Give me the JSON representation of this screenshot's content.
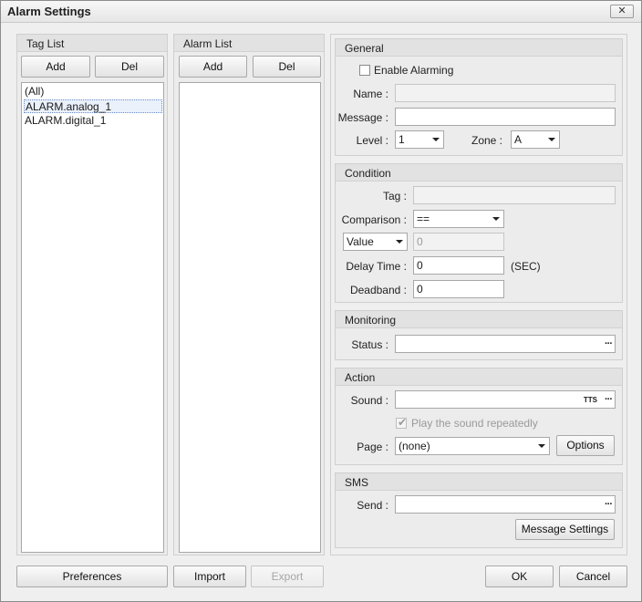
{
  "window": {
    "title": "Alarm Settings",
    "close_glyph": "✕"
  },
  "tag_list": {
    "title": "Tag List",
    "add_label": "Add",
    "del_label": "Del",
    "items": [
      "(All)",
      "ALARM.analog_1",
      "ALARM.digital_1"
    ]
  },
  "alarm_list": {
    "title": "Alarm List",
    "add_label": "Add",
    "del_label": "Del"
  },
  "general": {
    "title": "General",
    "enable_label": "Enable Alarming",
    "name_label": "Name :",
    "message_label": "Message :",
    "level_label": "Level :",
    "level_value": "1",
    "zone_label": "Zone :",
    "zone_value": "A"
  },
  "condition": {
    "title": "Condition",
    "tag_label": "Tag :",
    "comparison_label": "Comparison :",
    "comparison_value": "==",
    "value_type": "Value",
    "value": "0",
    "delay_label": "Delay Time :",
    "delay_value": "0",
    "delay_unit": "(SEC)",
    "deadband_label": "Deadband :",
    "deadband_value": "0"
  },
  "monitoring": {
    "title": "Monitoring",
    "status_label": "Status :",
    "browse_glyph": "···"
  },
  "action": {
    "title": "Action",
    "sound_label": "Sound :",
    "tts_label": "TTS",
    "browse_glyph": "···",
    "repeat_label": "Play the sound repeatedly",
    "page_label": "Page :",
    "page_value": "(none)",
    "options_label": "Options"
  },
  "sms": {
    "title": "SMS",
    "send_label": "Send :",
    "browse_glyph": "···",
    "message_settings_label": "Message Settings"
  },
  "footer": {
    "preferences_label": "Preferences",
    "import_label": "Import",
    "export_label": "Export",
    "ok_label": "OK",
    "cancel_label": "Cancel"
  }
}
